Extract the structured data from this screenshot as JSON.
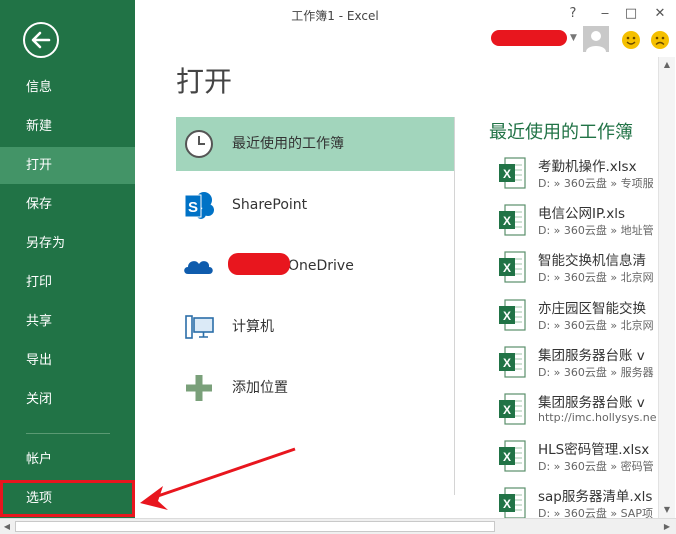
{
  "window": {
    "title": "工作簿1 - Excel",
    "help": "?",
    "minimize": "‒",
    "restore": "□",
    "close": "✕"
  },
  "sidebar": {
    "items": [
      {
        "label": "信息"
      },
      {
        "label": "新建"
      },
      {
        "label": "打开",
        "active": true
      },
      {
        "label": "保存"
      },
      {
        "label": "另存为"
      },
      {
        "label": "打印"
      },
      {
        "label": "共享"
      },
      {
        "label": "导出"
      },
      {
        "label": "关闭"
      }
    ],
    "account": "帐户",
    "options": "选项"
  },
  "page": {
    "title": "打开"
  },
  "locations": [
    {
      "label": "最近使用的工作簿",
      "icon": "clock-icon",
      "active": true
    },
    {
      "label": "SharePoint",
      "icon": "sharepoint-icon"
    },
    {
      "label": "OneDrive",
      "icon": "onedrive-cloud-icon"
    },
    {
      "label": "计算机",
      "icon": "computer-icon"
    },
    {
      "label": "添加位置",
      "icon": "plus-icon"
    }
  ],
  "recent": {
    "heading": "最近使用的工作簿",
    "files": [
      {
        "name": "考勤机操作.xlsx",
        "path": "D: » 360云盘 » 专项服"
      },
      {
        "name": "电信公网IP.xls",
        "path": "D: » 360云盘 » 地址管"
      },
      {
        "name": "智能交换机信息清",
        "path": "D: » 360云盘 » 北京网"
      },
      {
        "name": "亦庄园区智能交换",
        "path": "D: » 360云盘 » 北京网"
      },
      {
        "name": "集团服务器台账 v",
        "path": "D: » 360云盘 » 服务器"
      },
      {
        "name": "集团服务器台账 v",
        "path": "http://imc.hollysys.ne"
      },
      {
        "name": "HLS密码管理.xlsx",
        "path": "D: » 360云盘 » 密码管"
      },
      {
        "name": "sap服务器清单.xls",
        "path": "D: » 360云盘 » SAP项"
      }
    ]
  },
  "colors": {
    "brand_green": "#217346",
    "active_item": "#439467",
    "active_location": "#a2d5bc",
    "annotation_red": "#e8161e"
  }
}
